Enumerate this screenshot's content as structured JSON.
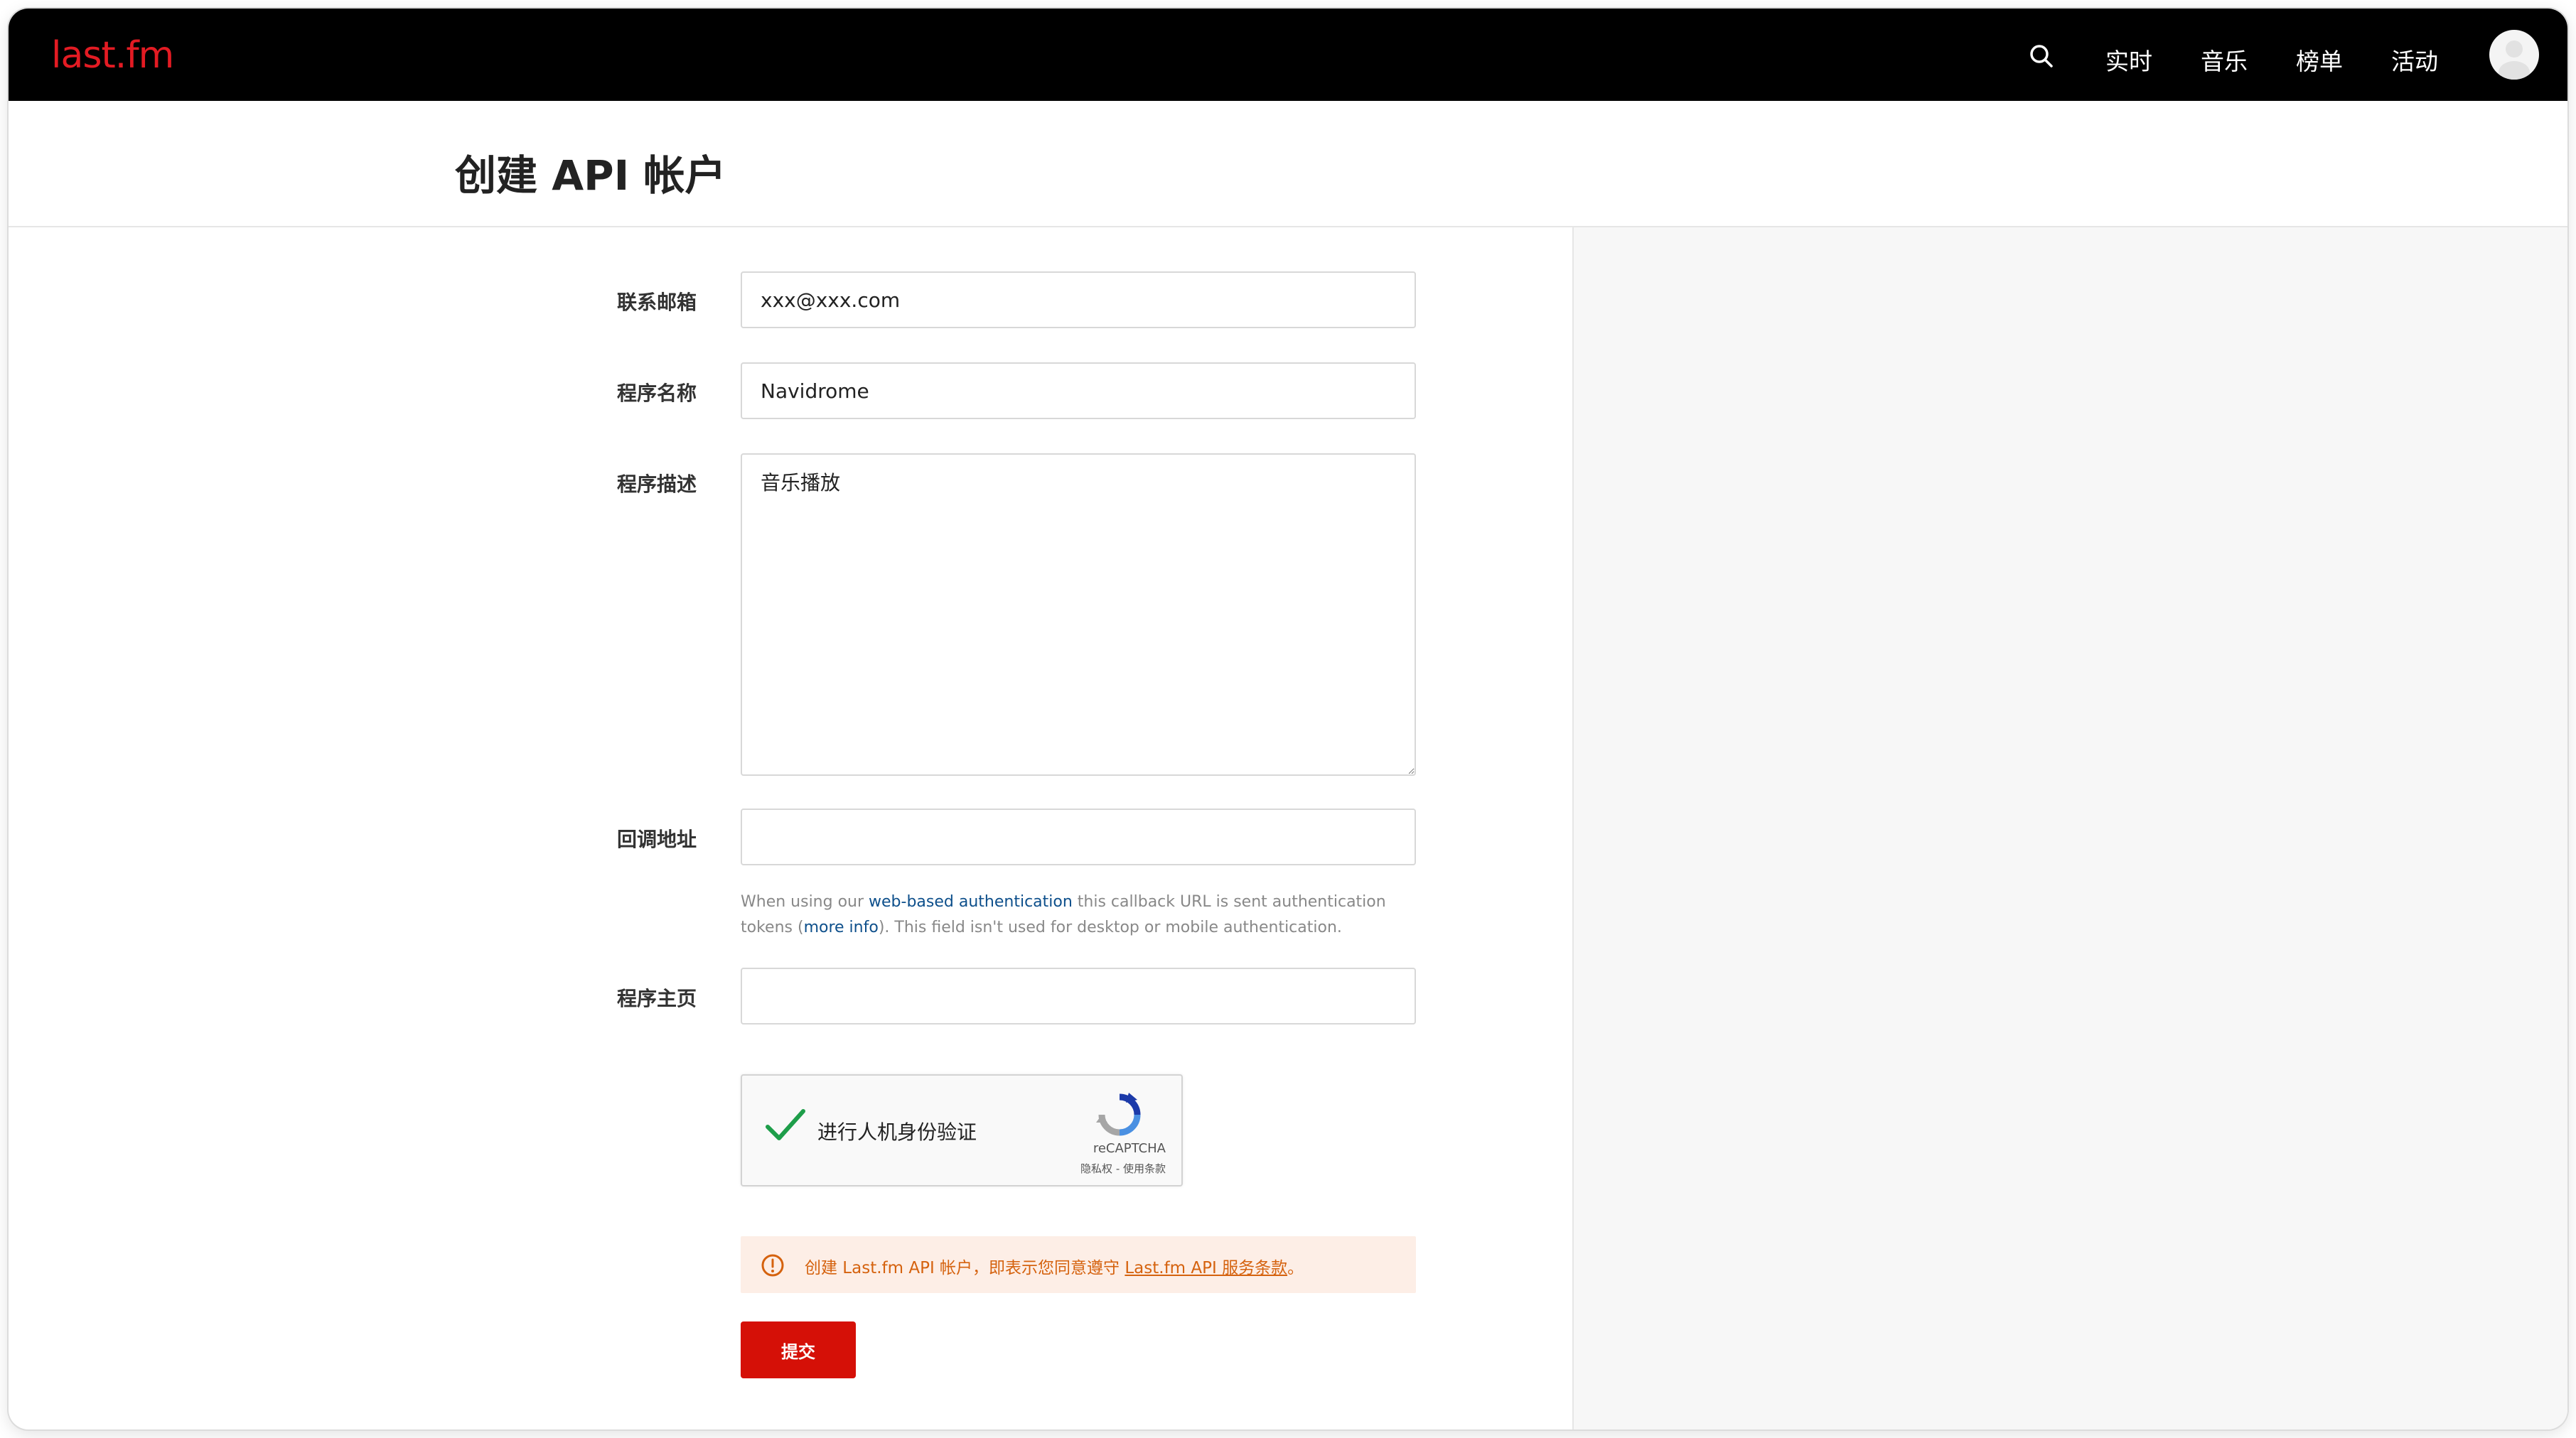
{
  "header": {
    "logo": "last.fm",
    "nav": [
      "实时",
      "音乐",
      "榜单",
      "活动"
    ]
  },
  "page": {
    "title": "创建 API 帐户"
  },
  "form": {
    "email_label": "联系邮箱",
    "email_value": "xxx@xxx.com",
    "app_name_label": "程序名称",
    "app_name_value": "Navidrome",
    "description_label": "程序描述",
    "description_value": "音乐播放",
    "callback_label": "回调地址",
    "callback_value": "",
    "help_prefix": "When using our ",
    "help_link1": "web-based authentication",
    "help_middle": " this callback URL is sent authentication tokens (",
    "help_link2": "more info",
    "help_suffix": "). This field isn't used for desktop or mobile authentication.",
    "homepage_label": "程序主页",
    "homepage_value": ""
  },
  "captcha": {
    "text": "进行人机身份验证",
    "brand": "reCAPTCHA",
    "links": "隐私权 - 使用条款",
    "checked": true
  },
  "notice": {
    "prefix": "创建 Last.fm API 帐户，即表示您同意遵守 ",
    "link": "Last.fm API 服务条款",
    "suffix": "。"
  },
  "submit_label": "提交",
  "colors": {
    "brand_red": "#d51007",
    "notice_bg": "#fdeee6",
    "notice_text": "#d5620e",
    "link_blue": "#0d4f8b"
  }
}
